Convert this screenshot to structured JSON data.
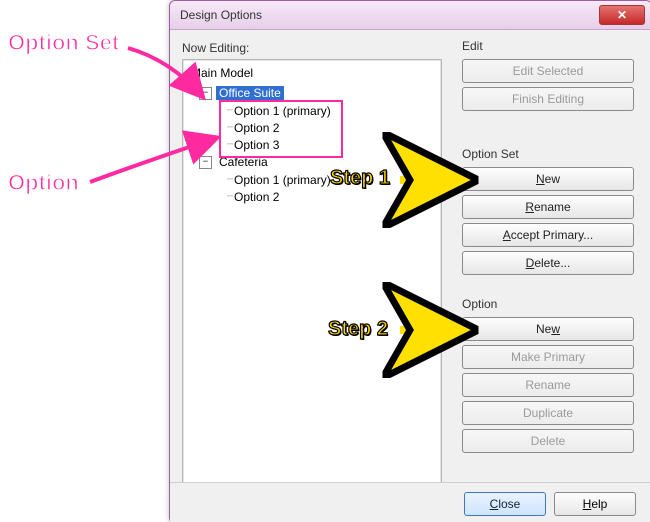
{
  "dialog": {
    "title": "Design Options"
  },
  "nowEditing": {
    "label": "Now Editing:"
  },
  "tree": {
    "root": "Main Model",
    "sets": [
      {
        "name": "Office Suite",
        "selected": true,
        "options": [
          "Option 1 (primary)",
          "Option 2",
          "Option 3"
        ]
      },
      {
        "name": "Cafeteria",
        "selected": false,
        "options": [
          "Option 1 (primary)",
          "Option 2"
        ]
      }
    ]
  },
  "panels": {
    "edit": {
      "label": "Edit",
      "editSelected": "Edit Selected",
      "finishEditing": "Finish Editing"
    },
    "optionSet": {
      "label": "Option Set",
      "new": "New",
      "rename": "Rename",
      "acceptPrimary": "Accept Primary...",
      "delete": "Delete..."
    },
    "option": {
      "label": "Option",
      "new": "New",
      "makePrimary": "Make Primary",
      "rename": "Rename",
      "duplicate": "Duplicate",
      "delete": "Delete"
    }
  },
  "footer": {
    "close": "Close",
    "help": "Help"
  },
  "annotations": {
    "optionSet": "Option Set",
    "option": "Option",
    "step1": "Step 1",
    "step2": "Step 2"
  },
  "glyph": {
    "minus": "−"
  }
}
